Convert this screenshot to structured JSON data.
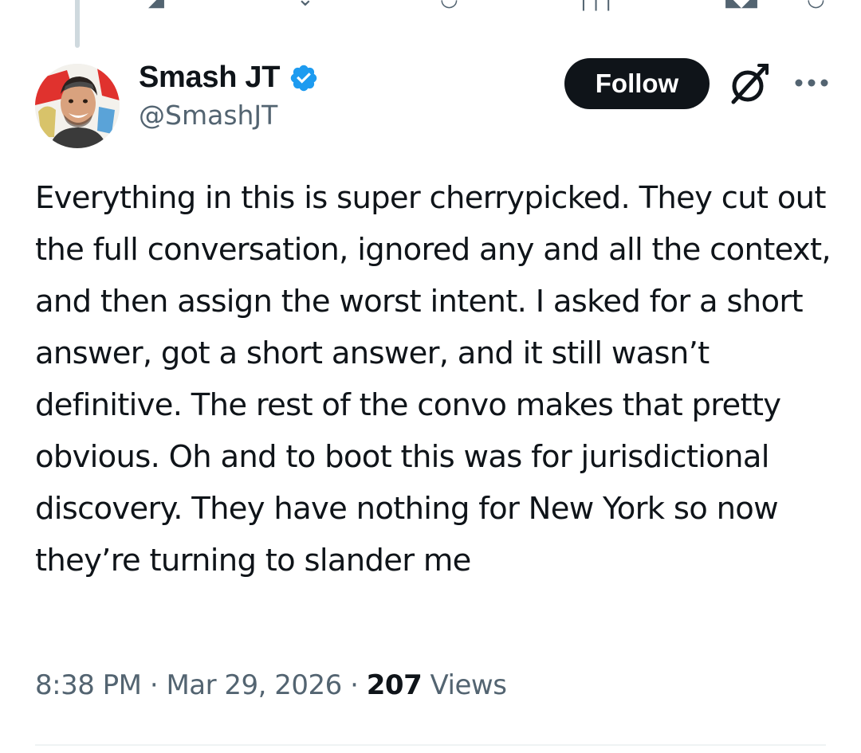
{
  "tweet": {
    "author": {
      "display_name": "Smash JT",
      "handle": "@SmashJT",
      "verified": true,
      "verified_color": "#1d9bf0"
    },
    "follow_label": "Follow",
    "text": "Everything in this is super cherrypicked. They cut out the full conversation, ignored any and all the context, and then assign the worst intent. I asked for a short answer, got a short answer, and it still wasn’t definitive. The rest of the convo makes that pretty obvious. Oh and to boot this was for jurisdictional discovery. They have nothing for New York so now they’re turning to slander me",
    "time": "8:38 PM",
    "date": "Mar 29, 2026",
    "separator": "·",
    "views_count": "207",
    "views_label": "Views"
  },
  "icons": {
    "grok": "grok-icon",
    "more": "more-icon"
  }
}
